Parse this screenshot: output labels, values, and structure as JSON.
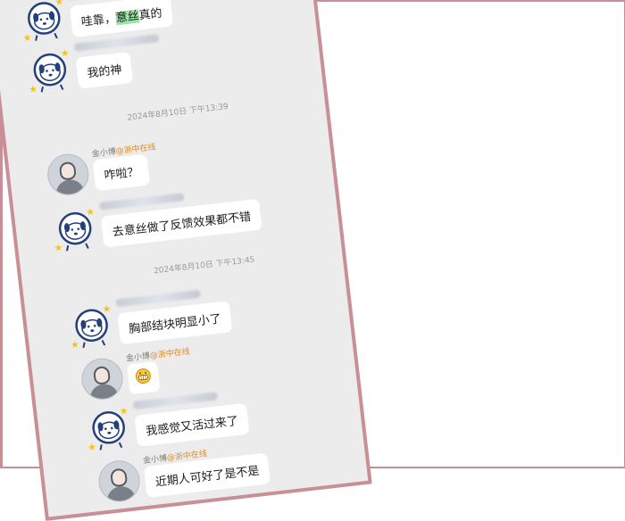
{
  "conversation": {
    "messages": [
      {
        "sender": "",
        "text_parts": [
          "哇靠，",
          "意丝",
          "真的"
        ],
        "avatar": "astronaut-dog"
      },
      {
        "sender": "",
        "text": "我的神",
        "avatar": "astronaut-dog"
      },
      {
        "time": "2024年8月10日 下午13:39"
      },
      {
        "sender_name": "金小博",
        "sender_tag": "@浙中在线",
        "text": "咋啦？",
        "avatar": "user-photo"
      },
      {
        "sender": "",
        "text": "去意丝做了反馈效果都不错",
        "avatar": "astronaut-dog"
      },
      {
        "time": "2024年8月10日 下午13:45"
      },
      {
        "sender": "",
        "text": "胸部结块明显小了",
        "avatar": "astronaut-dog"
      },
      {
        "sender_name": "金小博",
        "sender_tag": "@浙中在线",
        "emoji": "grinning-face",
        "avatar": "user-photo"
      },
      {
        "sender": "",
        "text": "我感觉又活过来了",
        "avatar": "astronaut-dog"
      },
      {
        "sender_name": "金小博",
        "sender_tag": "@浙中在线",
        "text": "近期人可好了是不是",
        "avatar": "user-photo"
      }
    ]
  },
  "colors": {
    "frame": "#c98f96",
    "chat_bg": "#ececec",
    "bubble": "#ffffff",
    "tag": "#e2892a",
    "highlight": "#9be3a6"
  }
}
